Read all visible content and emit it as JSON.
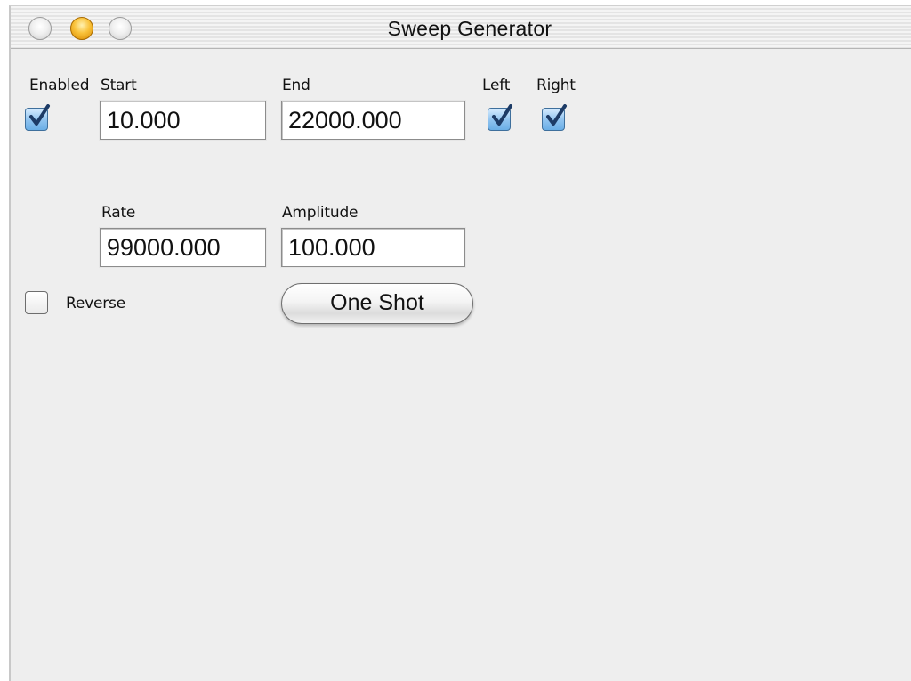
{
  "window": {
    "title": "Sweep Generator"
  },
  "controls": {
    "enabled": {
      "label": "Enabled",
      "checked": true
    },
    "start": {
      "label": "Start",
      "value": "10.000"
    },
    "end": {
      "label": "End",
      "value": "22000.000"
    },
    "left": {
      "label": "Left",
      "checked": true
    },
    "right": {
      "label": "Right",
      "checked": true
    },
    "rate": {
      "label": "Rate",
      "value": "99000.000"
    },
    "amplitude": {
      "label": "Amplitude",
      "value": "100.000"
    },
    "reverse": {
      "label": "Reverse",
      "checked": false
    },
    "one_shot": {
      "label": "One Shot"
    }
  },
  "colors": {
    "checkbox_checked": "#8ec2ef",
    "checkmark": "#1d3b66",
    "window_background": "#eeeeee",
    "traffic_light_active": "#f9c23a"
  }
}
